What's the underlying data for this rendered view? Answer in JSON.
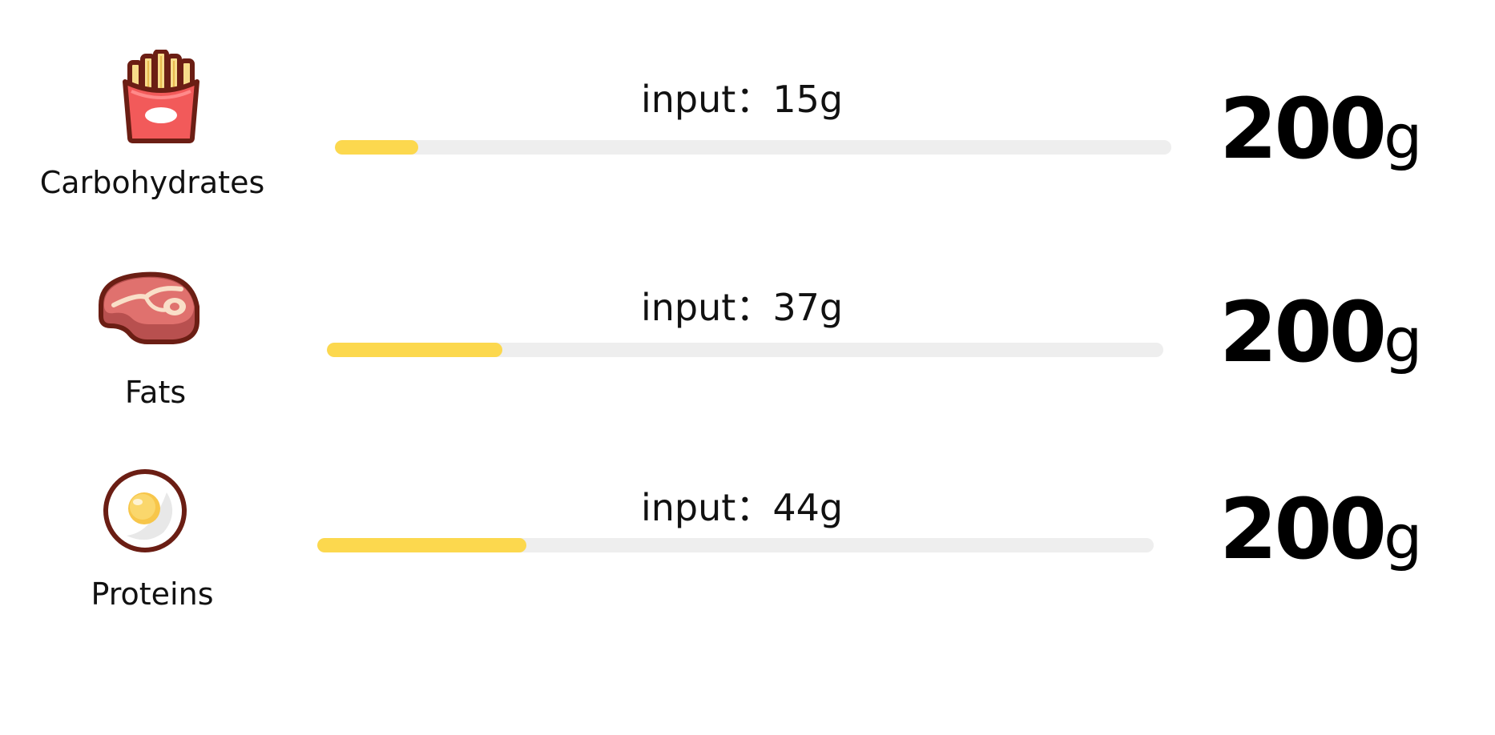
{
  "colors": {
    "accent": "#fcd84e",
    "track": "#eeeeee",
    "outline": "#6b1e14"
  },
  "nutrients": [
    {
      "name": "Carbohydrates",
      "icon": "fries-icon",
      "input_label": "input：15g",
      "input_value": 15,
      "progress_fraction": 0.1,
      "target_value": "200",
      "target_unit": "g"
    },
    {
      "name": "Fats",
      "icon": "steak-icon",
      "input_label": "input：37g",
      "input_value": 37,
      "progress_fraction": 0.21,
      "target_value": "200",
      "target_unit": "g"
    },
    {
      "name": "Proteins",
      "icon": "fried-egg-icon",
      "input_label": "input：44g",
      "input_value": 44,
      "progress_fraction": 0.25,
      "target_value": "200",
      "target_unit": "g"
    }
  ]
}
